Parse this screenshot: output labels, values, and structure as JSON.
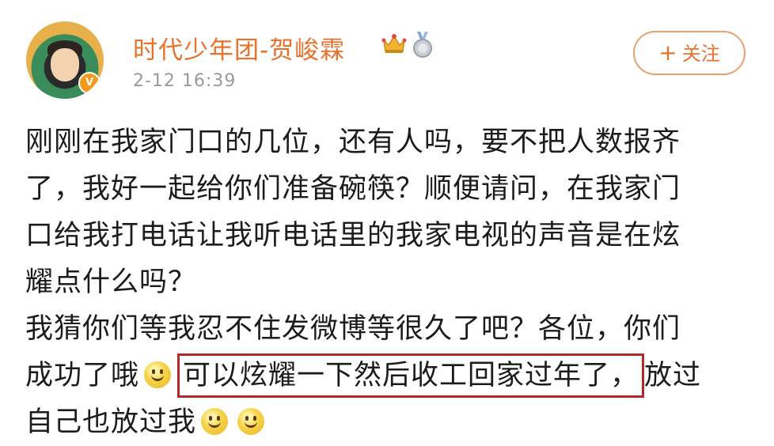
{
  "header": {
    "username": "时代少年团-贺峻霖",
    "timestamp": "2-12 16:39",
    "follow_label": "关注",
    "follow_plus": "+",
    "icons": [
      "crown-icon",
      "medal-icon"
    ],
    "accent_color": "#e8722c"
  },
  "post": {
    "lines": [
      "刚刚在我家门口的几位，还有人吗，要不把人数报齐",
      "了，我好一起给你们准备碗筷？顺便请问，在我家门",
      "口给我打电话让我听电话里的我家电视的声音是在炫",
      "耀点什么吗？",
      "我猜你们等我忍不住发微博等很久了吧？各位，你们"
    ],
    "line6_before": "成功了哦",
    "line6_highlight": "可以炫耀一下然后收工回家过年了，",
    "line6_after": "放过",
    "line7_text": "自己也放过我",
    "highlight_color": "#b5282a"
  }
}
